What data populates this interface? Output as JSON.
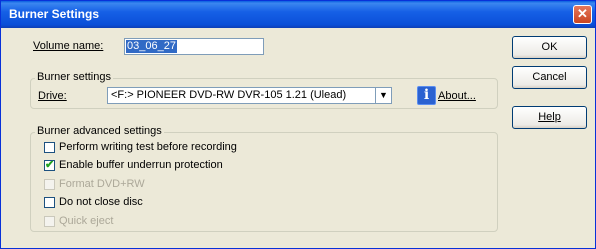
{
  "window": {
    "title": "Burner Settings",
    "close_symbol": "✕"
  },
  "volume": {
    "label": "Volume name:",
    "value": "03_06_27"
  },
  "buttons": {
    "ok": "OK",
    "cancel": "Cancel",
    "help": "Help"
  },
  "burner_settings": {
    "legend": "Burner settings",
    "drive_label": "Drive:",
    "drive_value": "<F:>  PIONEER DVD-RW DVR-105  1.21 (Ulead)",
    "dropdown_arrow": "▼",
    "about_icon": "i",
    "about_label": "About..."
  },
  "advanced": {
    "legend": "Burner advanced settings",
    "options": [
      {
        "label": "Perform writing test before recording",
        "checked": false,
        "enabled": true
      },
      {
        "label": "Enable buffer underrun protection",
        "checked": true,
        "enabled": true
      },
      {
        "label": "Format DVD+RW",
        "checked": false,
        "enabled": false
      },
      {
        "label": "Do not close disc",
        "checked": false,
        "enabled": true
      },
      {
        "label": "Quick eject",
        "checked": false,
        "enabled": false
      }
    ],
    "check_mark": "✔"
  }
}
